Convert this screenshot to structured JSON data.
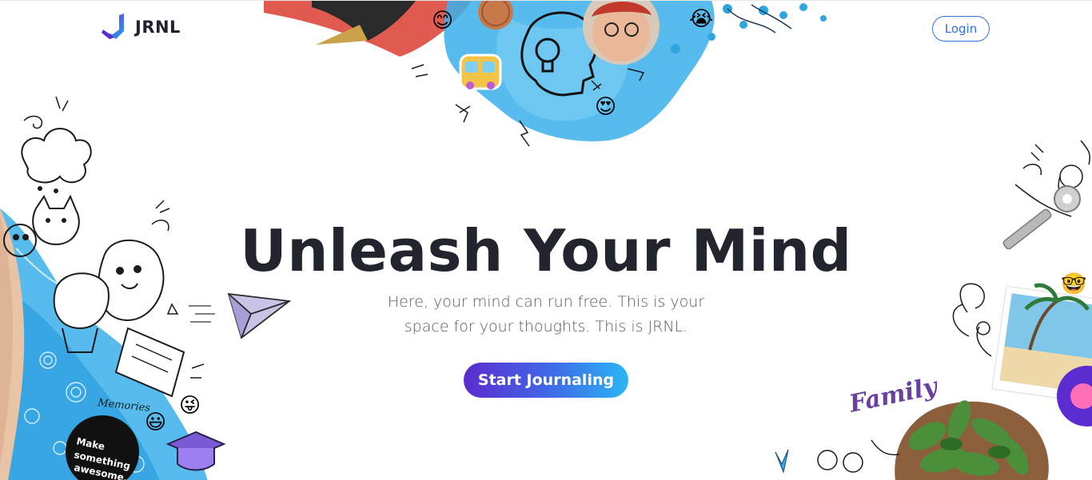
{
  "header": {
    "brand": "JRNL",
    "login_label": "Login"
  },
  "hero": {
    "title": "Unleash Your Mind",
    "subtitle": "Here, your mind can run free. This is your space for your thoughts. This is JRNL.",
    "cta_label": "Start Journaling"
  },
  "decorations": {
    "sticker_text": "Make something awesome.",
    "memories_label": "Memories",
    "family_label": "Family"
  },
  "colors": {
    "accent": "#2f6fe6",
    "cta_start": "#5b2ccf",
    "cta_end": "#29b6f3",
    "watercolor": "#3ab0ea",
    "title": "#22252d"
  }
}
